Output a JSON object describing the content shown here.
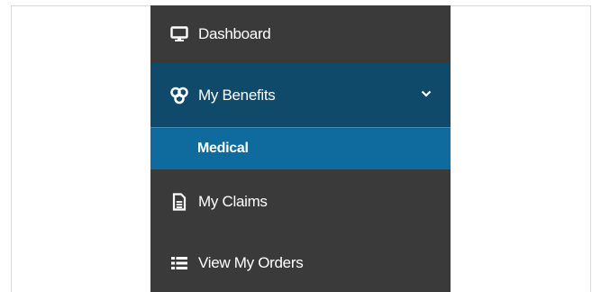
{
  "sidebar": {
    "items": [
      {
        "label": "Dashboard",
        "icon": "monitor-icon"
      },
      {
        "label": "My Benefits",
        "icon": "benefits-icon",
        "expanded": true
      },
      {
        "label": "Medical",
        "icon": "",
        "active": true
      },
      {
        "label": "My Claims",
        "icon": "document-icon"
      },
      {
        "label": "View My Orders",
        "icon": "list-icon"
      }
    ]
  },
  "colors": {
    "sidebar_bg": "#3a3a3a",
    "benefits_bg": "#0f4a6b",
    "active_bg": "#0f6a9e",
    "text": "#ffffff"
  }
}
